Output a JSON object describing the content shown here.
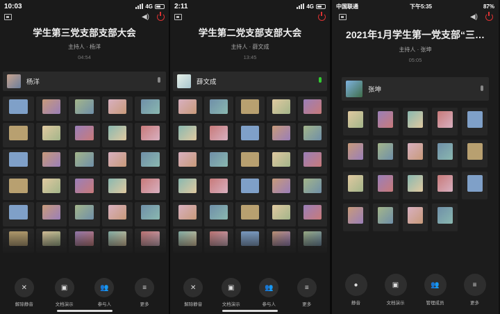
{
  "colors": {
    "background": "#1a1a1a",
    "tile": "#272727",
    "accent_red": "#dd3333",
    "accent_green": "#33cc33"
  },
  "panels": [
    {
      "status": {
        "time": "10:03",
        "network": "4G",
        "carrier": "",
        "battery": ""
      },
      "title": "学生第三党支部支部大会",
      "host": "主持人 · 杨洋",
      "timer": "04:54",
      "speaker": {
        "name": "杨洋",
        "mic": "muted"
      },
      "tiles": [
        "",
        "",
        "",
        "",
        "",
        "",
        "",
        "",
        "",
        "",
        "",
        "",
        "",
        "",
        "",
        "",
        "",
        "",
        "",
        "",
        "",
        "",
        "",
        "",
        "",
        "",
        "",
        "",
        "",
        ""
      ],
      "toolbar": [
        {
          "label": "解除静音",
          "icon": "mic-off-icon"
        },
        {
          "label": "文档演示",
          "icon": "share-folder-icon"
        },
        {
          "label": "参与人",
          "icon": "participants-icon"
        },
        {
          "label": "更多",
          "icon": "more-menu-icon"
        }
      ]
    },
    {
      "status": {
        "time": "2:11",
        "network": "4G",
        "carrier": "",
        "battery": ""
      },
      "title": "学生第二党支部支部大会",
      "host": "主持人 · 薛文成",
      "timer": "13:45",
      "speaker": {
        "name": "薛文成",
        "mic": "active"
      },
      "tiles": [
        "",
        "",
        "",
        "",
        "",
        "",
        "",
        "",
        "",
        "",
        "",
        "",
        "",
        "",
        "",
        "",
        "",
        "",
        "",
        "",
        "",
        "",
        "",
        "",
        "",
        "",
        "",
        "",
        "",
        ""
      ],
      "toolbar": [
        {
          "label": "解除静音",
          "icon": "mic-off-icon"
        },
        {
          "label": "文档演示",
          "icon": "share-folder-icon"
        },
        {
          "label": "参与人",
          "icon": "participants-icon"
        },
        {
          "label": "更多",
          "icon": "more-menu-icon"
        }
      ]
    },
    {
      "status": {
        "time": "下午5:35",
        "network": "",
        "carrier": "中国联通",
        "battery": "87%"
      },
      "title": "2021年1月学生第一党支部“三…",
      "host": "主持人 · 张坤",
      "timer": "05:05",
      "speaker": {
        "name": "张坤",
        "mic": "muted"
      },
      "tiles": [
        "",
        "",
        "",
        "",
        "",
        "",
        "",
        "",
        "",
        "",
        "",
        "",
        "",
        "",
        "",
        "",
        "",
        "",
        ""
      ],
      "toolbar": [
        {
          "label": "静音",
          "icon": "mic-icon"
        },
        {
          "label": "文档演示",
          "icon": "share-folder-icon"
        },
        {
          "label": "管理成员",
          "icon": "manage-members-icon"
        },
        {
          "label": "更多",
          "icon": "more-menu-icon"
        }
      ]
    }
  ]
}
